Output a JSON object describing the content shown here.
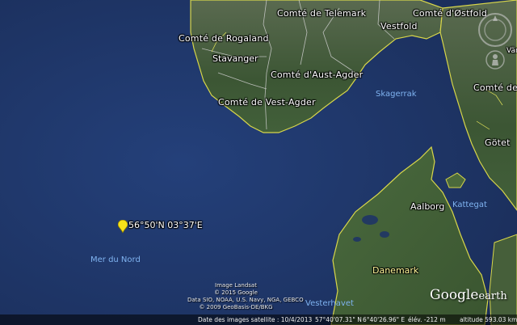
{
  "labels": {
    "telemark": "Comté de Telemark",
    "ostfold": "Comté d'Østfold",
    "rogaland": "Comté de Rogaland",
    "vestfold": "Vestfold",
    "stavanger": "Stavanger",
    "aust_agder": "Comté d'Aust-Agder",
    "vest_agder": "Comté de Vest-Agder",
    "skagerrak": "Skagerrak",
    "gotet": "Götet",
    "comte_right": "Comté de",
    "varm": "Värm",
    "aalborg": "Aalborg",
    "kattegat": "Kattegat",
    "danemark": "Danemark",
    "mer_du_nord": "Mer du Nord",
    "vesterhavet": "Vesterhavet"
  },
  "placemark": {
    "label": "56°50'N 03°37'E"
  },
  "credits": {
    "line1": "Image Landsat",
    "line2": "© 2015 Google",
    "line3": "Data SIO, NOAA, U.S. Navy, NGA, GEBCO",
    "line4": "© 2009 GeoBasis-DE/BKG"
  },
  "brand": {
    "google": "Google",
    "earth": "earth"
  },
  "status": {
    "image_date": "Date des images satellite : 10/4/2013",
    "lat": "57°40'07.31\" N",
    "lon": "6°40'26.96\" E",
    "elev": "élév. -212 m",
    "altitude": "altitude 593.03 km"
  },
  "colors": {
    "sea": "#1f3566",
    "land": "#3e5a36",
    "border": "#e8e85a"
  },
  "icons": {
    "nav": "compass-icon",
    "zoom": "street-view-icon",
    "pin": "pushpin-icon"
  }
}
